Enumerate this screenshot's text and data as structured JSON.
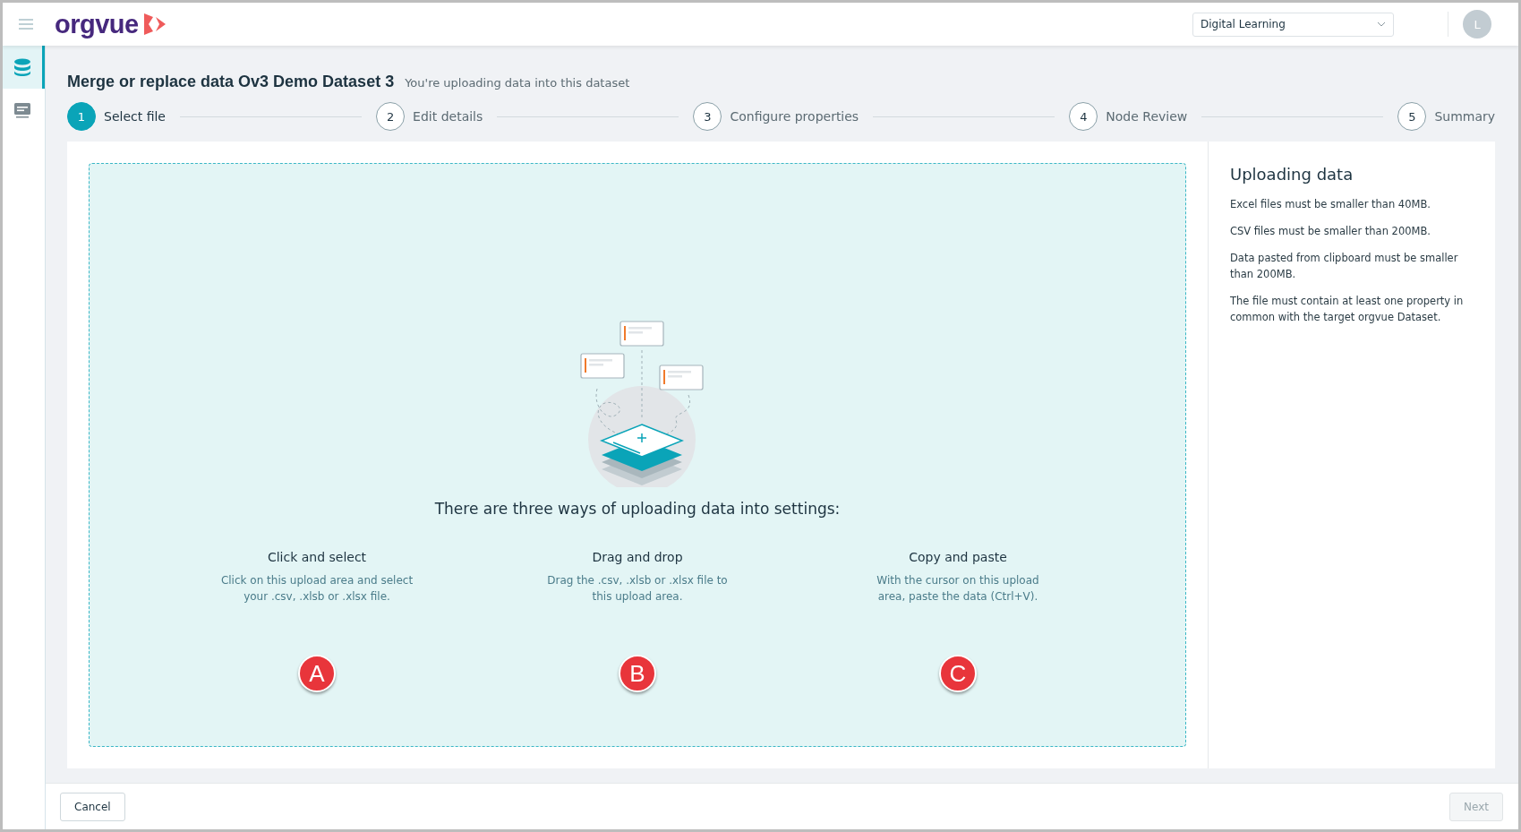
{
  "header": {
    "logo": "orgvue",
    "workspace_select": {
      "value": "Digital Learning"
    },
    "avatar": "L"
  },
  "sidebar": {
    "items": [
      {
        "kind": "database",
        "selected": true
      },
      {
        "kind": "message",
        "selected": false
      }
    ]
  },
  "page": {
    "title": "Merge or replace data Ov3 Demo Dataset 3",
    "subtitle": "You're uploading data into this dataset"
  },
  "steps": [
    {
      "number": "1",
      "label": "Select file",
      "selected": true
    },
    {
      "number": "2",
      "label": "Edit details",
      "selected": false
    },
    {
      "number": "3",
      "label": "Configure properties",
      "selected": false
    },
    {
      "number": "4",
      "label": "Node Review",
      "selected": false
    },
    {
      "number": "5",
      "label": "Summary",
      "selected": false
    }
  ],
  "upload_area": {
    "heading": "There are three ways of uploading data into settings:",
    "methods": [
      {
        "title": "Click and select",
        "description": "Click on this upload area and select your .csv, .xlsb or .xlsx file.",
        "marker": "A"
      },
      {
        "title": "Drag and drop",
        "description": "Drag the .csv, .xlsb or .xlsx file to this upload area.",
        "marker": "B"
      },
      {
        "title": "Copy and paste",
        "description": "With the cursor on this upload area, paste the data (Ctrl+V).",
        "marker": "C"
      }
    ]
  },
  "info_panel": {
    "title": "Uploading data",
    "notes": [
      "Excel files must be smaller than 40MB.",
      "CSV files must be smaller than 200MB.",
      "Data pasted from clipboard must be smaller than 200MB.",
      "The file must contain at least one property in common with the target orgvue Dataset."
    ]
  },
  "footer": {
    "cancel": {
      "label": "Cancel",
      "disabled": false
    },
    "next": {
      "label": "Next",
      "disabled": true
    }
  }
}
